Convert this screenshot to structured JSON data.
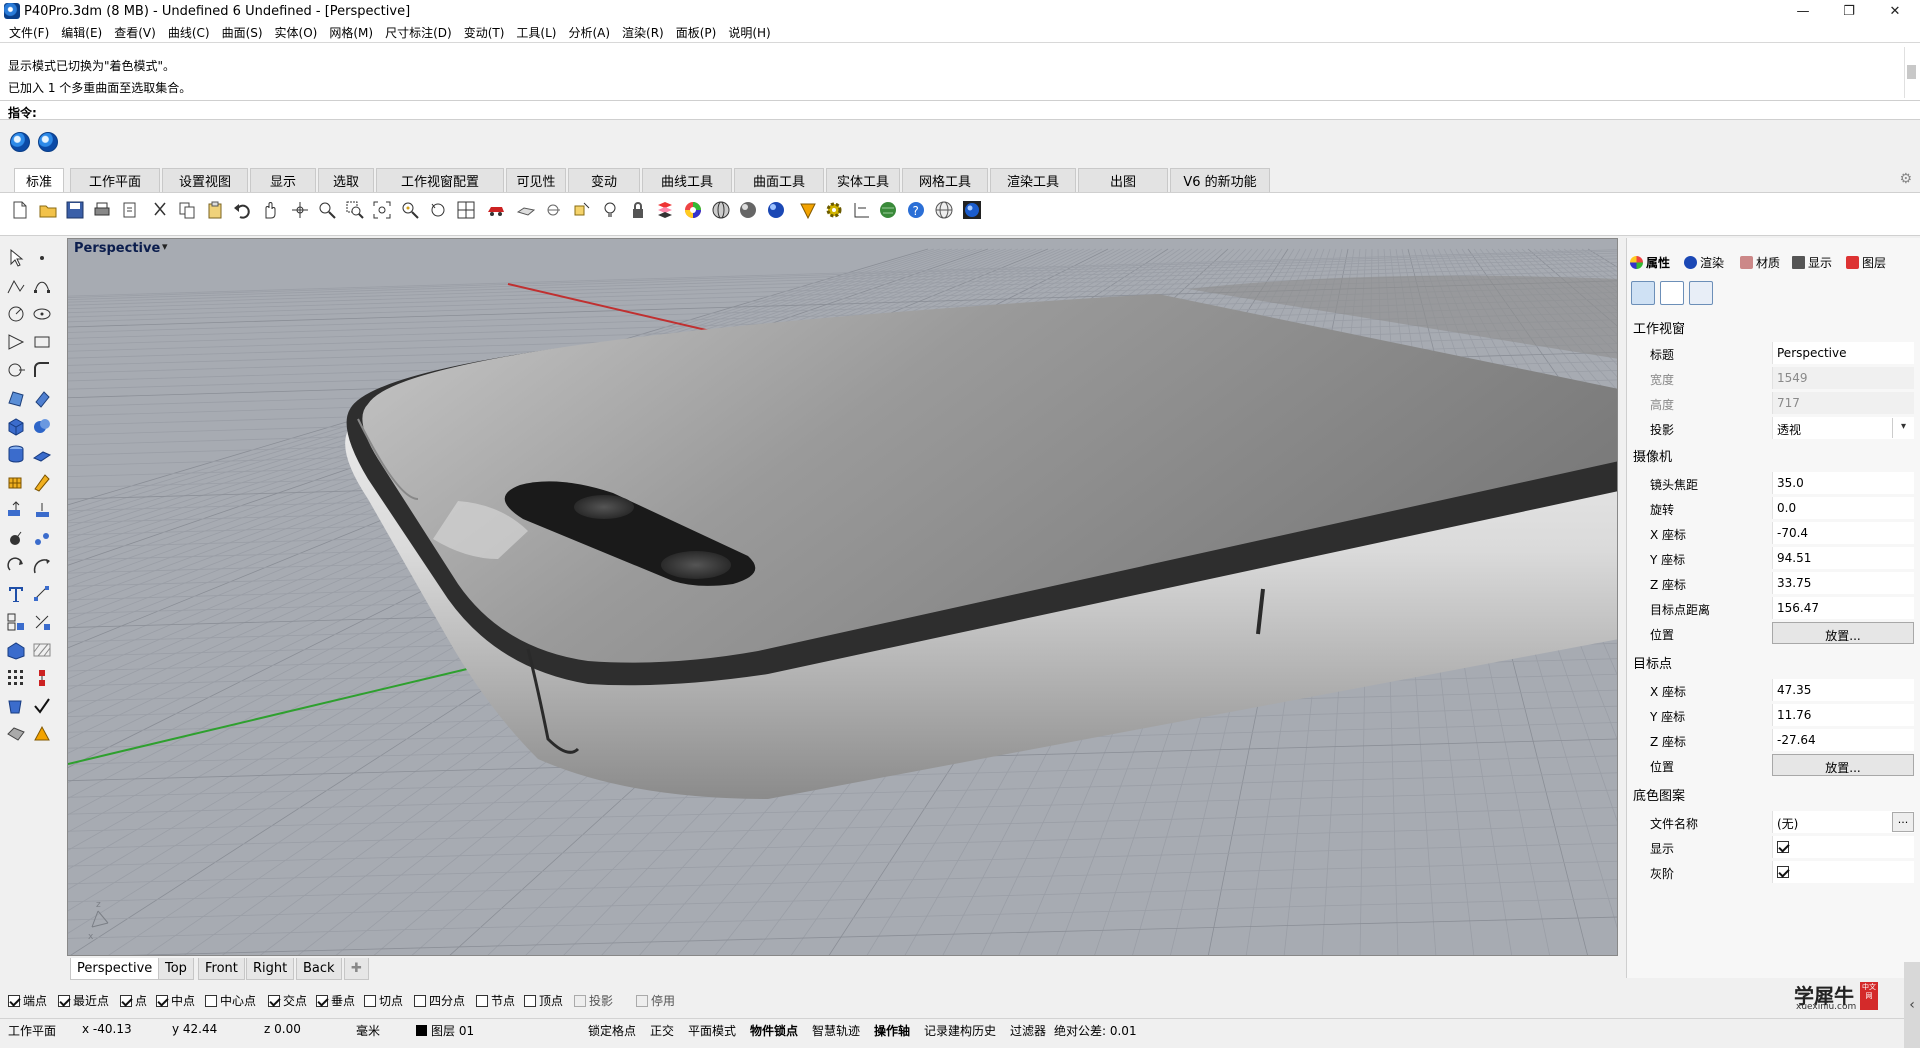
{
  "window": {
    "title": "P40Pro.3dm (8 MB) - Undefined 6 Undefined - [Perspective]",
    "minimize": "—",
    "maximize": "❐",
    "close": "✕"
  },
  "menu": [
    "文件(F)",
    "编辑(E)",
    "查看(V)",
    "曲线(C)",
    "曲面(S)",
    "实体(O)",
    "网格(M)",
    "尺寸标注(D)",
    "变动(T)",
    "工具(L)",
    "分析(A)",
    "渲染(R)",
    "面板(P)",
    "说明(H)"
  ],
  "command_history": {
    "line1": "显示模式已切换为\"着色模式\"。",
    "line2": "已加入 1 个多重曲面至选取集合。"
  },
  "command_prompt": "指令:",
  "tabs": [
    "标准",
    "工作平面",
    "设置视图",
    "显示",
    "选取",
    "工作视窗配置",
    "可见性",
    "变动",
    "曲线工具",
    "曲面工具",
    "实体工具",
    "网格工具",
    "渲染工具",
    "出图",
    "V6 的新功能"
  ],
  "active_tab": "标准",
  "viewport": {
    "title": "Perspective",
    "tabs": [
      "Perspective",
      "Top",
      "Front",
      "Right",
      "Back"
    ],
    "add_tab": "✚",
    "colors": {
      "background": "#a7abb2",
      "grid_minor": "#9a9ea6",
      "grid_major": "#8a8e96",
      "x_axis": "#c03030",
      "y_axis": "#2ea02e",
      "body": "#8c8c8c",
      "frame": "#2e2e2e",
      "camera": "#1a1a1a"
    }
  },
  "osnaps": [
    {
      "label": "端点",
      "checked": true
    },
    {
      "label": "最近点",
      "checked": true
    },
    {
      "label": "点",
      "checked": true
    },
    {
      "label": "中点",
      "checked": true
    },
    {
      "label": "中心点",
      "checked": false
    },
    {
      "label": "交点",
      "checked": true
    },
    {
      "label": "垂点",
      "checked": true
    },
    {
      "label": "切点",
      "checked": false
    },
    {
      "label": "四分点",
      "checked": false
    },
    {
      "label": "节点",
      "checked": false
    },
    {
      "label": "顶点",
      "checked": false
    },
    {
      "label": "投影",
      "checked": false,
      "disabled": true
    },
    {
      "label": "停用",
      "checked": false,
      "disabled": true
    }
  ],
  "status": {
    "cplane": "工作平面",
    "x": "x -40.13",
    "y": "y 42.44",
    "z": "z 0.00",
    "unit": "毫米",
    "layer": "图层 01",
    "grid_snap": "锁定格点",
    "ortho": "正交",
    "planar": "平面模式",
    "osnap": "物件锁点",
    "smarttrack": "智慧轨迹",
    "gumball": "操作轴",
    "history": "记录建构历史",
    "filter": "过滤器",
    "tolerance": "绝对公差: 0.01"
  },
  "panel": {
    "tabs": [
      "属性",
      "渲染",
      "材质",
      "显示",
      "图层"
    ],
    "viewport_section": "工作视窗",
    "title_label": "标题",
    "title_value": "Perspective",
    "width_label": "宽度",
    "width_value": "1549",
    "height_label": "高度",
    "height_value": "717",
    "projection_label": "投影",
    "projection_value": "透视",
    "camera_section": "摄像机",
    "lens_label": "镜头焦距",
    "lens_value": "35.0",
    "rotation_label": "旋转",
    "rotation_value": "0.0",
    "cam_x_label": "X 座标",
    "cam_x_value": "-70.4",
    "cam_y_label": "Y 座标",
    "cam_y_value": "94.51",
    "cam_z_label": "Z 座标",
    "cam_z_value": "33.75",
    "distance_label": "目标点距离",
    "distance_value": "156.47",
    "cam_position_label": "位置",
    "cam_position_button": "放置...",
    "target_section": "目标点",
    "tgt_x_label": "X 座标",
    "tgt_x_value": "47.35",
    "tgt_y_label": "Y 座标",
    "tgt_y_value": "11.76",
    "tgt_z_label": "Z 座标",
    "tgt_z_value": "-27.64",
    "tgt_position_label": "位置",
    "tgt_position_button": "放置...",
    "wallpaper_section": "底色图案",
    "file_label": "文件名称",
    "file_value": "(无)",
    "file_browse": "...",
    "show_label": "显示",
    "show_checked": true,
    "gray_label": "灰阶",
    "gray_checked": true
  },
  "watermark": {
    "text": "学犀牛",
    "site": "xuexiniu.com",
    "badge": "中文网"
  }
}
